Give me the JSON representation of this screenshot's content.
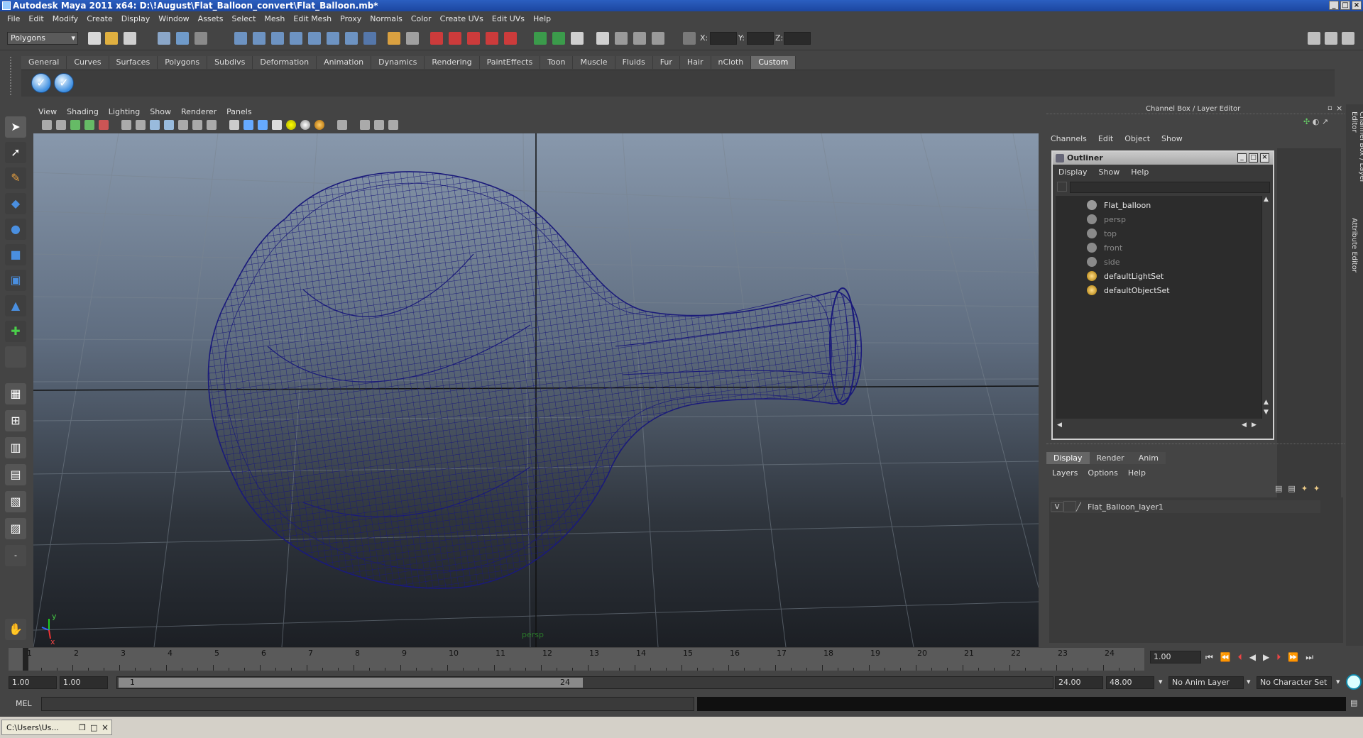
{
  "window": {
    "title": "Autodesk Maya 2011 x64: D:\\!August\\Flat_Balloon_convert\\Flat_Balloon.mb*"
  },
  "menu": [
    "File",
    "Edit",
    "Modify",
    "Create",
    "Display",
    "Window",
    "Assets",
    "Select",
    "Mesh",
    "Edit Mesh",
    "Proxy",
    "Normals",
    "Color",
    "Create UVs",
    "Edit UVs",
    "Help"
  ],
  "status": {
    "mode": "Polygons",
    "x_label": "X:",
    "y_label": "Y:",
    "z_label": "Z:"
  },
  "shelf_tabs": [
    "General",
    "Curves",
    "Surfaces",
    "Polygons",
    "Subdivs",
    "Deformation",
    "Animation",
    "Dynamics",
    "Rendering",
    "PaintEffects",
    "Toon",
    "Muscle",
    "Fluids",
    "Fur",
    "Hair",
    "nCloth",
    "Custom"
  ],
  "shelf_active_tab": "Custom",
  "viewport": {
    "menu": [
      "View",
      "Shading",
      "Lighting",
      "Show",
      "Renderer",
      "Panels"
    ],
    "camera_label": "persp",
    "axis_x": "x",
    "axis_y": "y",
    "mesh_color": "#1a1a7a"
  },
  "channel_box": {
    "title": "Channel Box / Layer Editor",
    "menu": [
      "Channels",
      "Edit",
      "Object",
      "Show"
    ]
  },
  "outliner": {
    "title": "Outliner",
    "menu": [
      "Display",
      "Show",
      "Help"
    ],
    "items": [
      {
        "label": "Flat_balloon",
        "icon": "transform-icon",
        "dim": false
      },
      {
        "label": "persp",
        "icon": "camera-icon",
        "dim": true
      },
      {
        "label": "top",
        "icon": "camera-icon",
        "dim": true
      },
      {
        "label": "front",
        "icon": "camera-icon",
        "dim": true
      },
      {
        "label": "side",
        "icon": "camera-icon",
        "dim": true
      },
      {
        "label": "defaultLightSet",
        "icon": "set-icon",
        "dim": false
      },
      {
        "label": "defaultObjectSet",
        "icon": "set-icon",
        "dim": false
      }
    ]
  },
  "layer_editor": {
    "tabs": [
      "Display",
      "Render",
      "Anim"
    ],
    "menu": [
      "Layers",
      "Options",
      "Help"
    ],
    "layer": {
      "visible": "V",
      "name": "Flat_Balloon_layer1"
    }
  },
  "timeline": {
    "labels": [
      "1",
      "2",
      "3",
      "4",
      "5",
      "6",
      "7",
      "8",
      "9",
      "10",
      "11",
      "12",
      "13",
      "14",
      "15",
      "16",
      "17",
      "18",
      "19",
      "20",
      "21",
      "22",
      "23",
      "24"
    ],
    "current_frame": "1.00"
  },
  "range": {
    "start": "1.00",
    "playback_start": "1.00",
    "slider_start": "1",
    "slider_end": "24",
    "playback_end": "24.00",
    "end": "48.00",
    "anim_layer": "No Anim Layer",
    "character_set": "No Character Set"
  },
  "command": {
    "label": "MEL"
  },
  "taskbar": {
    "item": "C:\\Users\\Us..."
  },
  "side_tabs": [
    "Channel Box / Layer Editor",
    "Attribute Editor"
  ]
}
